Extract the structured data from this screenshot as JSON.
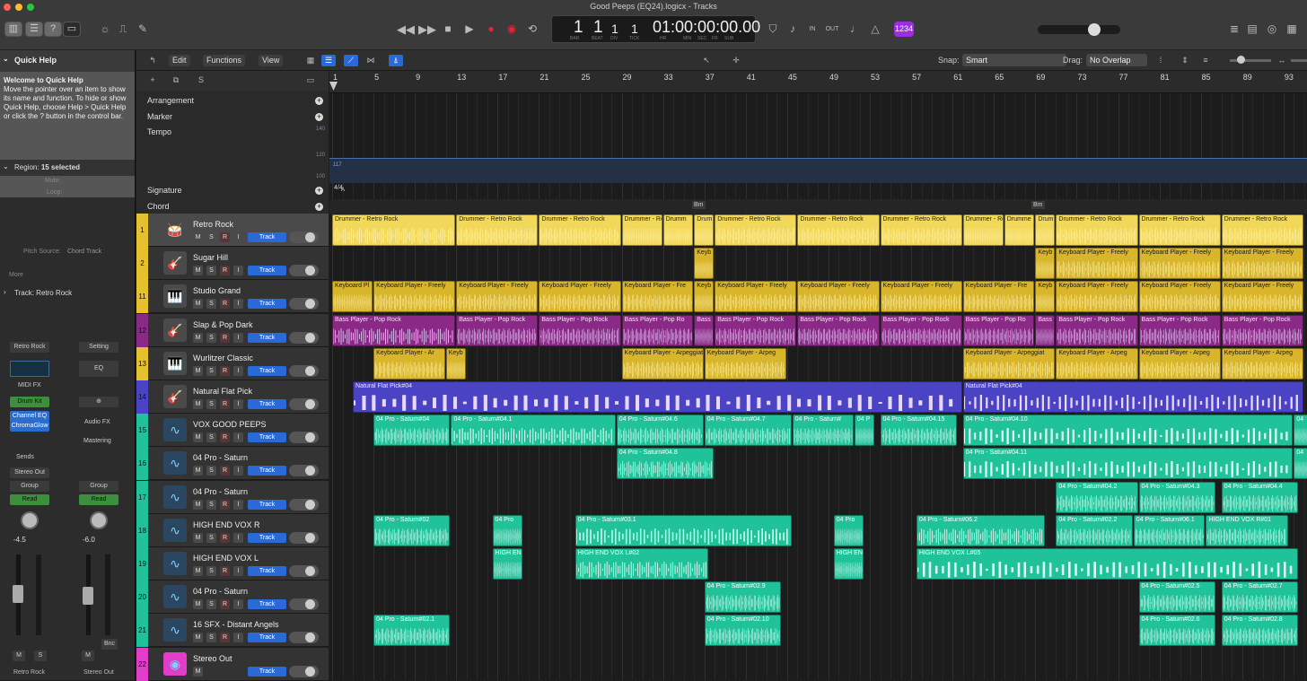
{
  "window": {
    "title": "Good Peeps (EQ24).logicx - Tracks"
  },
  "lcd": {
    "bar": "1",
    "beat": "1",
    "div": "1",
    "tick": "1",
    "time": "01:00:00:00.00",
    "labels": [
      "BAR",
      "BEAT",
      "DIV",
      "TICK",
      "HR",
      "MIN",
      "SEC",
      "FR",
      "SUB"
    ]
  },
  "keysig": "1234",
  "quick_help": {
    "header": "Quick Help",
    "title": "Welcome to Quick Help",
    "body": "Move the pointer over an item to show its name and function. To hide or show Quick Help, choose Help > Quick Help or click the ? button in the control bar."
  },
  "inspector": {
    "region_label": "Region:",
    "region_value": "15 selected",
    "mute_label": "Mute:",
    "loop_label": "Loop:",
    "pitch_source_label": "Pitch Source:",
    "pitch_source_value": "Chord Track",
    "more": "More",
    "track_label": "Track:",
    "track_value": "Retro Rock"
  },
  "channel_strips": {
    "left": {
      "setting": "Retro Rock",
      "midi_fx": "MIDI FX",
      "instrument": "Drum Kit",
      "plugins": [
        "Channel EQ",
        "ChromaGlow"
      ],
      "sends": "Sends",
      "output": "Stereo Out",
      "group": "Group",
      "automation": "Read",
      "pan_value": "-4.5",
      "name": "Retro Rock",
      "m": "M",
      "s": "S"
    },
    "right": {
      "setting": "Setting",
      "eq": "EQ",
      "audio_fx": "Audio FX",
      "mastering": "Mastering",
      "group": "Group",
      "automation": "Read",
      "pan_value": "-6.0",
      "name": "Stereo Out",
      "m": "M",
      "bnc": "Bnc"
    }
  },
  "toolbar": {
    "edit": "Edit",
    "functions": "Functions",
    "view": "View",
    "snap_label": "Snap:",
    "snap_value": "Smart",
    "drag_label": "Drag:",
    "drag_value": "No Overlap"
  },
  "global_tracks": {
    "arrangement": "Arrangement",
    "marker": "Marker",
    "tempo": "Tempo",
    "tempo_ticks": [
      "140",
      "120",
      "100"
    ],
    "tempo_value": "117",
    "signature": "Signature",
    "signature_value": "4/4",
    "key": "A",
    "chord": "Chord",
    "chords": [
      "Bm",
      "Bm"
    ]
  },
  "ruler_marks": [
    "1",
    "5",
    "9",
    "13",
    "17",
    "21",
    "25",
    "29",
    "33",
    "37",
    "41",
    "45",
    "49",
    "53",
    "57",
    "61",
    "65",
    "69",
    "73",
    "77",
    "81",
    "85",
    "89",
    "93"
  ],
  "track_button_label": "Track",
  "mute_label": "M",
  "solo_label": "S",
  "rec_label": "R",
  "input_label": "I",
  "colors": {
    "drums": "#f2d85a",
    "keys": "#d8b52a",
    "bass": "#8a2a86",
    "guitar": "#4a44c4",
    "audio": "#20c29a",
    "output": "#e23dc8"
  },
  "tracks": [
    {
      "num": "1",
      "name": "Retro Rock",
      "icon": "drum-kit-icon",
      "color": "#e6c12e",
      "buttons": [
        "M",
        "S",
        "R",
        "I"
      ]
    },
    {
      "num": "2",
      "name": "Sugar Hill",
      "icon": "guitar-icon",
      "color": "#e6c12e",
      "buttons": [
        "M",
        "S",
        "R",
        "I"
      ]
    },
    {
      "num": "11",
      "name": "Studio Grand",
      "icon": "piano-icon",
      "color": "#e6c12e",
      "buttons": [
        "M",
        "S",
        "R",
        "I"
      ]
    },
    {
      "num": "12",
      "name": "Slap & Pop Dark",
      "icon": "bass-guitar-icon",
      "color": "#8a2a86",
      "buttons": [
        "M",
        "S",
        "R",
        "I"
      ]
    },
    {
      "num": "13",
      "name": "Wurlitzer Classic",
      "icon": "electric-piano-icon",
      "color": "#e6c12e",
      "buttons": [
        "M",
        "S",
        "R",
        "I"
      ]
    },
    {
      "num": "14",
      "name": "Natural Flat Pick",
      "icon": "acoustic-guitar-icon",
      "color": "#4a44c4",
      "buttons": [
        "M",
        "S",
        "R",
        "I"
      ]
    },
    {
      "num": "15",
      "name": "VOX GOOD PEEPS",
      "icon": "waveform-icon",
      "color": "#20c29a",
      "buttons": [
        "M",
        "S",
        "R",
        "I"
      ]
    },
    {
      "num": "16",
      "name": "04 Pro - Saturn",
      "icon": "waveform-icon",
      "color": "#20c29a",
      "buttons": [
        "M",
        "S",
        "R",
        "I"
      ]
    },
    {
      "num": "17",
      "name": "04 Pro - Saturn",
      "icon": "waveform-icon",
      "color": "#20c29a",
      "buttons": [
        "M",
        "S",
        "R",
        "I"
      ]
    },
    {
      "num": "18",
      "name": "HIGH END VOX R",
      "icon": "waveform-icon",
      "color": "#20c29a",
      "buttons": [
        "M",
        "S",
        "R",
        "I"
      ]
    },
    {
      "num": "19",
      "name": "HIGH END VOX L",
      "icon": "waveform-icon",
      "color": "#20c29a",
      "buttons": [
        "M",
        "S",
        "R",
        "I"
      ]
    },
    {
      "num": "20",
      "name": "04 Pro - Saturn",
      "icon": "waveform-icon",
      "color": "#20c29a",
      "buttons": [
        "M",
        "S",
        "R",
        "I"
      ]
    },
    {
      "num": "21",
      "name": "16 SFX - Distant Angels",
      "icon": "waveform-icon",
      "color": "#20c29a",
      "buttons": [
        "M",
        "S",
        "R",
        "I"
      ]
    },
    {
      "num": "22",
      "name": "Stereo Out",
      "icon": "output-icon",
      "color": "#e23dc8",
      "buttons": [
        "M"
      ]
    }
  ],
  "regions": [
    [
      {
        "bar": 1,
        "len": 12,
        "name": "Drummer - Retro Rock"
      },
      {
        "bar": 13,
        "len": 8,
        "name": "Drummer - Retro Rock"
      },
      {
        "bar": 21,
        "len": 8,
        "name": "Drummer - Retro Rock"
      },
      {
        "bar": 29,
        "len": 4,
        "name": "Drummer - Retro Rock"
      },
      {
        "bar": 33,
        "len": 3,
        "name": "Drumm"
      },
      {
        "bar": 36,
        "len": 2,
        "name": "Drum"
      },
      {
        "bar": 38,
        "len": 8,
        "name": "Drummer - Retro Rock"
      },
      {
        "bar": 46,
        "len": 8,
        "name": "Drummer - Retro Rock"
      },
      {
        "bar": 54,
        "len": 8,
        "name": "Drummer - Retro Rock"
      },
      {
        "bar": 62,
        "len": 4,
        "name": "Drummer - Retro Rock"
      },
      {
        "bar": 66,
        "len": 3,
        "name": "Drumme"
      },
      {
        "bar": 69,
        "len": 2,
        "name": "Drum"
      },
      {
        "bar": 71,
        "len": 8,
        "name": "Drummer - Retro Rock"
      },
      {
        "bar": 79,
        "len": 8,
        "name": "Drummer - Retro Rock"
      },
      {
        "bar": 87,
        "len": 8,
        "name": "Drummer - Retro Rock"
      }
    ],
    [
      {
        "bar": 36,
        "len": 2,
        "name": "Keyb"
      },
      {
        "bar": 69,
        "len": 2,
        "name": "Keyb"
      },
      {
        "bar": 71,
        "len": 8,
        "name": "Keyboard Player - Freely"
      },
      {
        "bar": 79,
        "len": 8,
        "name": "Keyboard Player - Freely"
      },
      {
        "bar": 87,
        "len": 8,
        "name": "Keyboard Player - Freely"
      }
    ],
    [
      {
        "bar": 1,
        "len": 4,
        "name": "Keyboard Pl"
      },
      {
        "bar": 5,
        "len": 8,
        "name": "Keyboard Player - Freely"
      },
      {
        "bar": 13,
        "len": 8,
        "name": "Keyboard Player - Freely"
      },
      {
        "bar": 21,
        "len": 8,
        "name": "Keyboard Player - Freely"
      },
      {
        "bar": 29,
        "len": 7,
        "name": "Keyboard Player - Fre"
      },
      {
        "bar": 36,
        "len": 2,
        "name": "Keyb"
      },
      {
        "bar": 38,
        "len": 8,
        "name": "Keyboard Player - Freely"
      },
      {
        "bar": 46,
        "len": 8,
        "name": "Keyboard Player - Freely"
      },
      {
        "bar": 54,
        "len": 8,
        "name": "Keyboard Player - Freely"
      },
      {
        "bar": 62,
        "len": 7,
        "name": "Keyboard Player - Fre"
      },
      {
        "bar": 69,
        "len": 2,
        "name": "Keyb"
      },
      {
        "bar": 71,
        "len": 8,
        "name": "Keyboard Player - Freely"
      },
      {
        "bar": 79,
        "len": 8,
        "name": "Keyboard Player - Freely"
      },
      {
        "bar": 87,
        "len": 8,
        "name": "Keyboard Player - Freely"
      }
    ],
    [
      {
        "bar": 1,
        "len": 12,
        "name": "Bass Player - Pop Rock"
      },
      {
        "bar": 13,
        "len": 8,
        "name": "Bass Player - Pop Rock"
      },
      {
        "bar": 21,
        "len": 8,
        "name": "Bass Player - Pop Rock"
      },
      {
        "bar": 29,
        "len": 7,
        "name": "Bass Player - Pop Ro"
      },
      {
        "bar": 36,
        "len": 2,
        "name": "Bass"
      },
      {
        "bar": 38,
        "len": 8,
        "name": "Bass Player - Pop Rock"
      },
      {
        "bar": 46,
        "len": 8,
        "name": "Bass Player - Pop Rock"
      },
      {
        "bar": 54,
        "len": 8,
        "name": "Bass Player - Pop Rock"
      },
      {
        "bar": 62,
        "len": 7,
        "name": "Bass Player - Pop Ro"
      },
      {
        "bar": 69,
        "len": 2,
        "name": "Bass"
      },
      {
        "bar": 71,
        "len": 8,
        "name": "Bass Player - Pop Rock"
      },
      {
        "bar": 79,
        "len": 8,
        "name": "Bass Player - Pop Rock"
      },
      {
        "bar": 87,
        "len": 8,
        "name": "Bass Player - Pop Rock"
      }
    ],
    [
      {
        "bar": 5,
        "len": 7,
        "name": "Keyboard Player - Ar"
      },
      {
        "bar": 12,
        "len": 2,
        "name": "Keyb"
      },
      {
        "bar": 29,
        "len": 8,
        "name": "Keyboard Player - Arpeggiat"
      },
      {
        "bar": 37,
        "len": 8,
        "name": "Keyboard Player - Arpeg"
      },
      {
        "bar": 62,
        "len": 9,
        "name": "Keyboard Player - Arpeggiat"
      },
      {
        "bar": 71,
        "len": 8,
        "name": "Keyboard Player - Arpeg"
      },
      {
        "bar": 79,
        "len": 8,
        "name": "Keyboard Player - Arpeg"
      },
      {
        "bar": 87,
        "len": 8,
        "name": "Keyboard Player - Arpeg"
      }
    ],
    [
      {
        "bar": 3,
        "len": 59,
        "name": "Natural Flat Pick#04"
      },
      {
        "bar": 62,
        "len": 33,
        "name": "Natural Flat Pick#04"
      }
    ],
    [
      {
        "bar": 5,
        "len": 7.5,
        "name": "04 Pro - Saturn#04"
      },
      {
        "bar": 12.5,
        "len": 16,
        "name": "04 Pro - Saturn#04.1"
      },
      {
        "bar": 28.5,
        "len": 8.5,
        "name": "04 Pro - Saturn#04.6"
      },
      {
        "bar": 37,
        "len": 8.5,
        "name": "04 Pro - Saturn#04.7"
      },
      {
        "bar": 45.5,
        "len": 6,
        "name": "04 Pro - Saturn#"
      },
      {
        "bar": 51.5,
        "len": 2,
        "name": "04 P"
      },
      {
        "bar": 54,
        "len": 7.5,
        "name": "04 Pro - Saturn#04.15"
      },
      {
        "bar": 62,
        "len": 32,
        "name": "04 Pro - Saturn#04.10"
      },
      {
        "bar": 94,
        "len": 2,
        "name": "04"
      }
    ],
    [
      {
        "bar": 28.5,
        "len": 9.5,
        "name": "04 Pro - Saturn#04.8"
      },
      {
        "bar": 62,
        "len": 32,
        "name": "04 Pro - Saturn#04.11"
      },
      {
        "bar": 94,
        "len": 2,
        "name": "04"
      }
    ],
    [
      {
        "bar": 71,
        "len": 8,
        "name": "04 Pro - Saturn#04.2"
      },
      {
        "bar": 79,
        "len": 7.5,
        "name": "04 Pro - Saturn#04.3"
      },
      {
        "bar": 87,
        "len": 7.5,
        "name": "04 Pro - Saturn#04.4"
      }
    ],
    [
      {
        "bar": 5,
        "len": 7.5,
        "name": "04 Pro - Saturn#02"
      },
      {
        "bar": 16.5,
        "len": 3,
        "name": "04 Pro"
      },
      {
        "bar": 24.5,
        "len": 21,
        "name": "04 Pro - Saturn#03.1"
      },
      {
        "bar": 49.5,
        "len": 3,
        "name": "04 Pro"
      },
      {
        "bar": 57.5,
        "len": 12.5,
        "name": "04 Pro - Saturn#06.2"
      },
      {
        "bar": 71,
        "len": 7.5,
        "name": "04 Pro - Saturn#02.2"
      },
      {
        "bar": 78.5,
        "len": 7,
        "name": "04 Pro - Saturn#06.1"
      },
      {
        "bar": 85.5,
        "len": 8,
        "name": "HIGH END VOX R#01"
      }
    ],
    [
      {
        "bar": 16.5,
        "len": 3,
        "name": "HIGH EN"
      },
      {
        "bar": 24.5,
        "len": 13,
        "name": "HIGH END VOX L#02"
      },
      {
        "bar": 49.5,
        "len": 3,
        "name": "HIGH EN"
      },
      {
        "bar": 57.5,
        "len": 37,
        "name": "HIGH END VOX L#05"
      }
    ],
    [
      {
        "bar": 37,
        "len": 7.5,
        "name": "04 Pro - Saturn#02.9"
      },
      {
        "bar": 79,
        "len": 7.5,
        "name": "04 Pro - Saturn#02.5"
      },
      {
        "bar": 87,
        "len": 7.5,
        "name": "04 Pro - Saturn#02.7"
      }
    ],
    [
      {
        "bar": 5,
        "len": 7.5,
        "name": "04 Pro - Saturn#02.1"
      },
      {
        "bar": 37,
        "len": 7.5,
        "name": "04 Pro - Saturn#02.10"
      },
      {
        "bar": 79,
        "len": 7.5,
        "name": "04 Pro - Saturn#02.6"
      },
      {
        "bar": 87,
        "len": 7.5,
        "name": "04 Pro - Saturn#02.8"
      }
    ],
    []
  ]
}
